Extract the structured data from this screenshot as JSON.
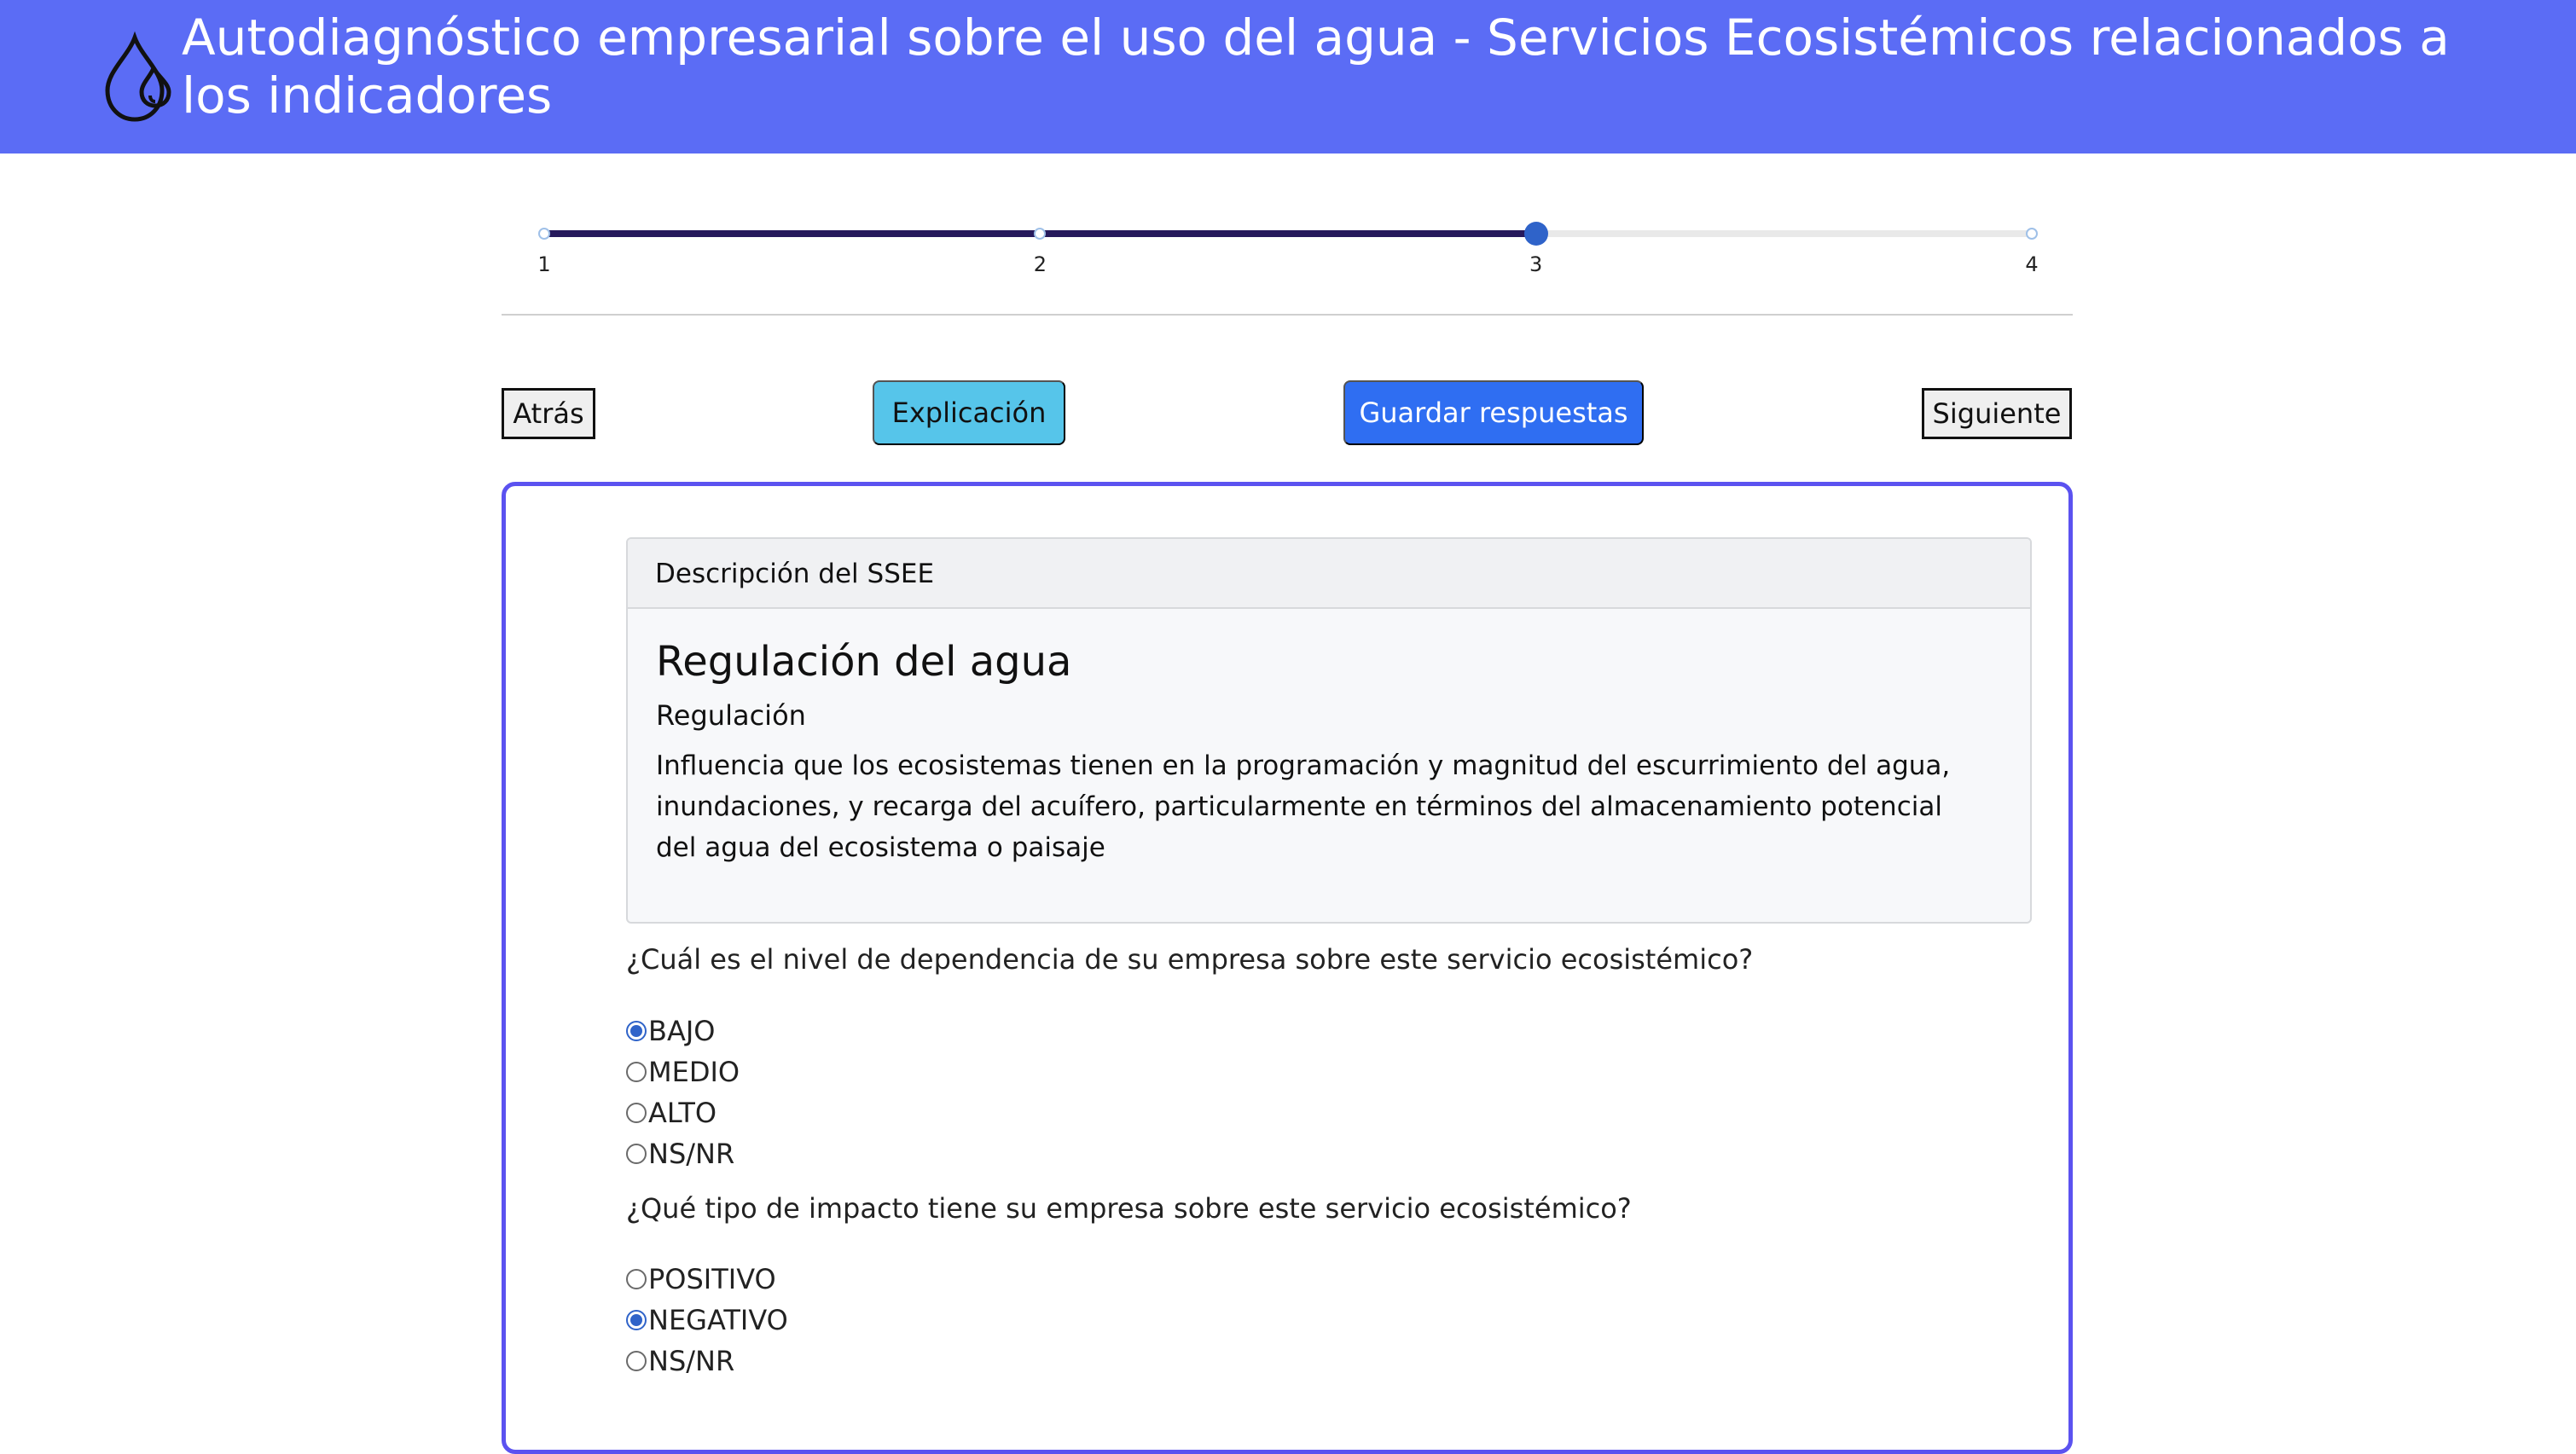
{
  "header": {
    "title": "Autodiagnóstico empresarial sobre el uso del agua - Servicios Ecosistémicos relacionados a los indicadores",
    "icon": "water-drops-icon",
    "background_color": "#5b6cf5"
  },
  "stepper": {
    "steps": [
      "1",
      "2",
      "3",
      "4"
    ],
    "current_step": 3,
    "fill_color": "#26195c",
    "active_color": "#2f63c9"
  },
  "nav": {
    "back_label": "Atrás",
    "explain_label": "Explicación",
    "save_label": "Guardar respuestas",
    "next_label": "Siguiente"
  },
  "card": {
    "header": "Descripción del SSEE",
    "title": "Regulación del agua",
    "subtitle": "Regulación",
    "description": "Influencia que los ecosistemas tienen en la programación y magnitud del escurrimiento del agua, inundaciones, y recarga del acuífero, particularmente en términos del almacenamiento potencial del agua del ecosistema o paisaje"
  },
  "questions": [
    {
      "text": "¿Cuál es el nivel de dependencia de su empresa sobre este servicio ecosistémico?",
      "options": [
        "BAJO",
        "MEDIO",
        "ALTO",
        "NS/NR"
      ],
      "selected": "BAJO"
    },
    {
      "text": "¿Qué tipo de impacto tiene su empresa sobre este servicio ecosistémico?",
      "options": [
        "POSITIVO",
        "NEGATIVO",
        "NS/NR"
      ],
      "selected": "NEGATIVO"
    }
  ]
}
